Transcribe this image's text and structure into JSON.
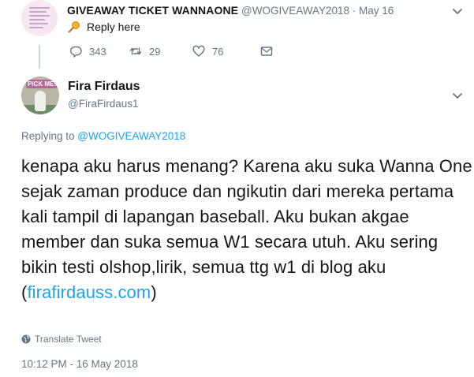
{
  "parent_tweet": {
    "name": "GIVEAWAY TICKET WANNAONE",
    "handle": "@WOGIVEAWAY2018",
    "separator": "·",
    "date": "May 16",
    "reply_label": "Reply here",
    "reply_emoji": "lollipop-icon",
    "stats": {
      "replies": "343",
      "retweets": "29",
      "likes": "76"
    }
  },
  "main_tweet": {
    "name": "Fira Firdaus",
    "handle": "@FiraFirdaus1",
    "replying_prefix": "Replying to ",
    "replying_to": "@WOGIVEAWAY2018",
    "text_before_link": "kenapa aku harus menang? Karena aku suka Wanna One sejak zaman produce dan ngikutin dari mereka pertama kali tampil di lapangan baseball. Aku bukan akgae member dan suka semua W1 secara utuh. Aku sering bikin testi olshop,lirik, semua ttg w1 di blog aku (",
    "link": "firafirdauss.com",
    "text_after_link": ")",
    "translate_label": "Translate Tweet",
    "timestamp": "10:12 PM - 16 May 2018",
    "avatar_label": "PICK ME!"
  },
  "colors": {
    "link": "#1da1f2",
    "secondary_text": "#657786",
    "thread_line": "#ccd6dd"
  }
}
